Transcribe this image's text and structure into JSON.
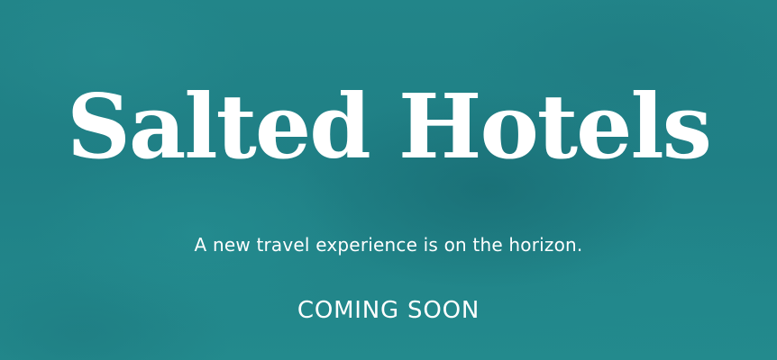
{
  "hero": {
    "title": "Salted Hotels",
    "tagline": "A new travel experience is on the horizon.",
    "status": "COMING SOON"
  },
  "colors": {
    "background": "#23878a",
    "text": "#ffffff"
  }
}
